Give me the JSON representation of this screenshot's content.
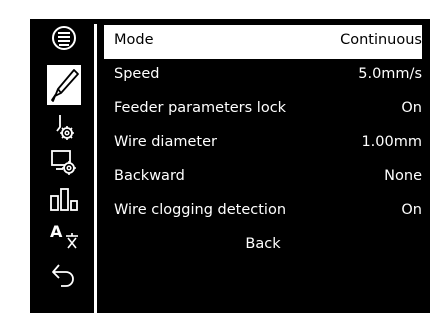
{
  "sidebar": {
    "icons": [
      {
        "name": "list-icon"
      },
      {
        "name": "pen-icon",
        "active": true
      },
      {
        "name": "nozzle-settings-icon"
      },
      {
        "name": "display-settings-icon"
      },
      {
        "name": "bar-chart-icon"
      },
      {
        "name": "language-icon",
        "text": "A"
      },
      {
        "name": "back-arrow-icon"
      }
    ]
  },
  "menu": {
    "rows": [
      {
        "label": "Mode",
        "value": "Continuous"
      },
      {
        "label": "Speed",
        "value": "5.0mm/s"
      },
      {
        "label": "Feeder parameters lock",
        "value": "On"
      },
      {
        "label": "Wire diameter",
        "value": "1.00mm"
      },
      {
        "label": "Backward",
        "value": "None"
      },
      {
        "label": "Wire clogging detection",
        "value": "On"
      }
    ],
    "back_label": "Back"
  },
  "colors": {
    "background": "#000000",
    "foreground": "#ffffff",
    "frame": "#ffffff"
  }
}
